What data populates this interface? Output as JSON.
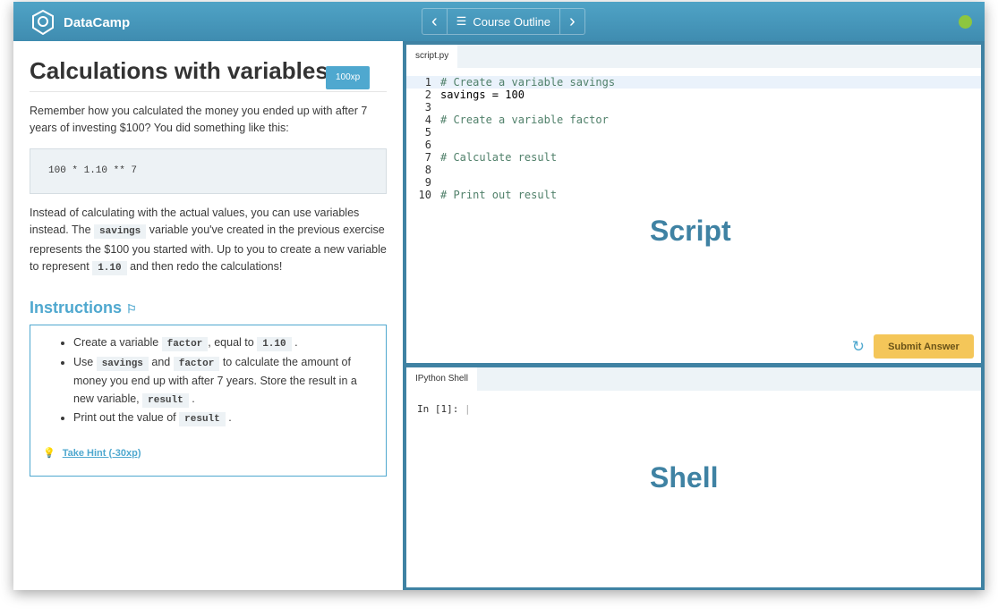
{
  "header": {
    "brand": "DataCamp",
    "course_outline": "Course Outline",
    "prev": "‹",
    "next": "›"
  },
  "exercise": {
    "title": "Calculations with variables",
    "xp": "100xp",
    "p1": "Remember how you calculated the money you ended up with after 7 years of investing $100? You did something like this:",
    "snippet": "100 * 1.10 ** 7",
    "p2a": "Instead of calculating with the actual values, you can use variables instead. The ",
    "p2b": "savings",
    "p2c": " variable you've created in the previous exercise represents the $100 you started with. Up to you to create a new variable to represent ",
    "p2d": "1.10",
    "p2e": " and then redo the calculations!",
    "instructions_title": "Instructions",
    "i1a": "Create a variable ",
    "i1b": "factor",
    "i1c": ", equal to ",
    "i1d": "1.10",
    "i1e": ".",
    "i2a": "Use ",
    "i2b": "savings",
    "i2c": " and ",
    "i2d": "factor",
    "i2e": " to calculate the amount of money you end up with after 7 years. Store the result in a new variable, ",
    "i2f": "result",
    "i2g": ".",
    "i3a": "Print out the value of ",
    "i3b": "result",
    "i3c": ".",
    "hint": "Take Hint (-30xp)"
  },
  "editor": {
    "tab": "script.py",
    "label": "Script",
    "submit": "Submit Answer",
    "lines": [
      "# Create a variable savings",
      "savings = 100",
      "",
      "# Create a variable factor",
      "",
      "",
      "# Calculate result",
      "",
      "",
      "# Print out result"
    ]
  },
  "shell": {
    "tab": "IPython Shell",
    "prompt": "In [1]:",
    "label": "Shell"
  }
}
